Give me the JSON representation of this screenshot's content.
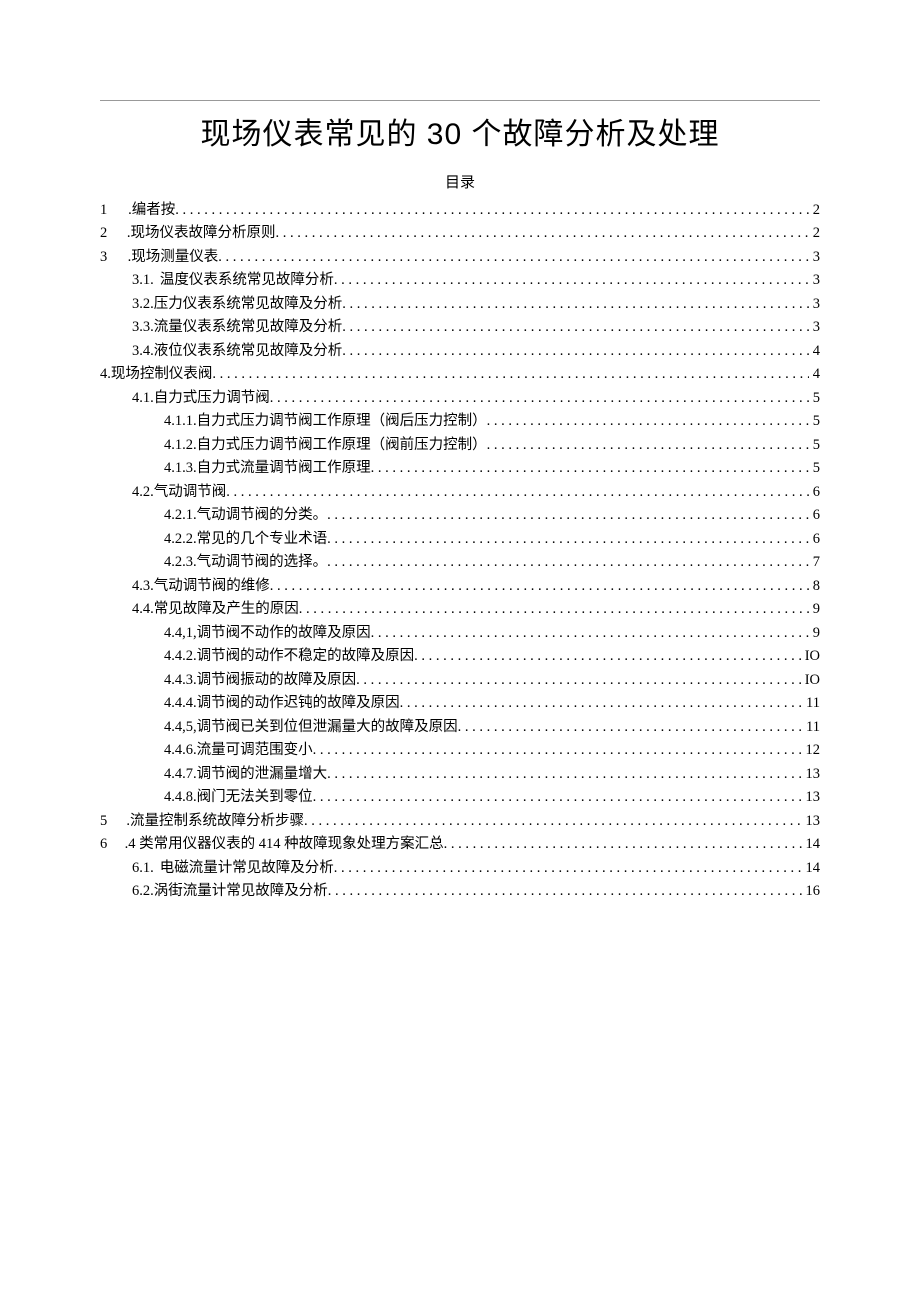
{
  "title": "现场仪表常见的 30 个故障分析及处理",
  "toc_heading": "目录",
  "toc": [
    {
      "level": 1,
      "num": "1",
      "sep": "wide",
      "label": ".编者按",
      "page": "2"
    },
    {
      "level": 1,
      "num": "2",
      "sep": "wide",
      "label": ".现场仪表故障分析原则 ",
      "page": "2"
    },
    {
      "level": 1,
      "num": "3",
      "sep": "wide",
      "label": ".现场测量仪表 ",
      "page": "3"
    },
    {
      "level": 2,
      "num": "3.1.",
      "sep": "gap",
      "label": "温度仪表系统常见故障分析",
      "page": "3"
    },
    {
      "level": 2,
      "num": "3.2.",
      "sep": "",
      "label": "压力仪表系统常见故障及分析 ",
      "page": "3"
    },
    {
      "level": 2,
      "num": "3.3.",
      "sep": "",
      "label": "流量仪表系统常见故障及分析 ",
      "page": "3"
    },
    {
      "level": 2,
      "num": "3.4.",
      "sep": "",
      "label": "液位仪表系统常见故障及分析 ",
      "page": "4"
    },
    {
      "level": 1,
      "num": "4.",
      "sep": "",
      "label": "现场控制仪表阀 ",
      "page": "4"
    },
    {
      "level": 2,
      "num": "4.1.",
      "sep": "",
      "label": "自力式压力调节阀 ",
      "page": "5"
    },
    {
      "level": 3,
      "num": "4.1.1.",
      "sep": "",
      "label": "自力式压力调节阀工作原理（阀后压力控制） ",
      "page": "5"
    },
    {
      "level": 3,
      "num": "4.1.2.",
      "sep": "",
      "label": "自力式压力调节阀工作原理（阀前压力控制） ",
      "page": "5"
    },
    {
      "level": 3,
      "num": "4.1.3.",
      "sep": "",
      "label": "自力式流量调节阀工作原理 ",
      "page": "5"
    },
    {
      "level": 2,
      "num": "4.2.",
      "sep": "",
      "label": "气动调节阀 ",
      "page": "6"
    },
    {
      "level": 3,
      "num": "4.2.1.",
      "sep": "",
      "label": "气动调节阀的分类。 ",
      "page": "6"
    },
    {
      "level": 3,
      "num": "4.2.2.",
      "sep": "",
      "label": "常见的几个专业术语 ",
      "page": "6"
    },
    {
      "level": 3,
      "num": "4.2.3.",
      "sep": "",
      "label": "气动调节阀的选择。 ",
      "page": "7"
    },
    {
      "level": 2,
      "num": "4.3.",
      "sep": "",
      "label": "气动调节阀的维修 ",
      "page": "8"
    },
    {
      "level": 2,
      "num": "4.4.",
      "sep": "",
      "label": "常见故障及产生的原因 ",
      "page": "9"
    },
    {
      "level": 3,
      "num": "4.4,1,",
      "sep": "",
      "label": "调节阀不动作的故障及原因 ",
      "page": "9"
    },
    {
      "level": 3,
      "num": "4.4.2.",
      "sep": "",
      "label": "调节阀的动作不稳定的故障及原因 ",
      "page": "IO"
    },
    {
      "level": 3,
      "num": "4.4.3.",
      "sep": "",
      "label": "调节阀振动的故障及原因 ",
      "page": "IO"
    },
    {
      "level": 3,
      "num": "4.4.4.",
      "sep": "",
      "label": "调节阀的动作迟钝的故障及原因 ",
      "page": "11"
    },
    {
      "level": 3,
      "num": "4.4,5,",
      "sep": "",
      "label": "调节阀已关到位但泄漏量大的故障及原因 ",
      "page": "11"
    },
    {
      "level": 3,
      "num": "4.4.6.",
      "sep": "",
      "label": "流量可调范围变小 ",
      "page": "12"
    },
    {
      "level": 3,
      "num": "4.4.7.",
      "sep": "",
      "label": "调节阀的泄漏量增大 ",
      "page": "13"
    },
    {
      "level": 3,
      "num": "4.4.8.",
      "sep": "",
      "label": "阀门无法关到零位 ",
      "page": "13"
    },
    {
      "level": 1,
      "num": "5",
      "sep": "wide",
      "label": ".流量控制系统故障分析步骤 ",
      "page": "13"
    },
    {
      "level": 1,
      "num": "6",
      "sep": "wide",
      "label": ".4 类常用仪器仪表的 414 种故障现象处理方案汇总 ",
      "page": "14"
    },
    {
      "level": 2,
      "num": "6.1.",
      "sep": "gap",
      "label": "电磁流量计常见故障及分析",
      "page": "14"
    },
    {
      "level": 2,
      "num": "6.2.",
      "sep": "",
      "label": "涡街流量计常见故障及分析 ",
      "page": "16"
    }
  ]
}
